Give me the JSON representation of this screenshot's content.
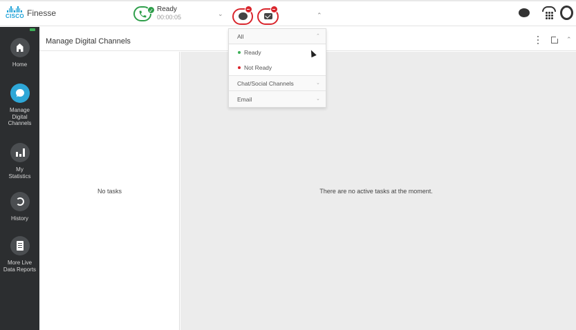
{
  "header": {
    "app_name": "Finesse",
    "logo_text": "CISCO",
    "status": "Ready",
    "status_timer": "00:00:05"
  },
  "sidebar": {
    "items": [
      {
        "label": "Home",
        "icon": "home-icon"
      },
      {
        "label": "Manage Digital Channels",
        "label_lines": [
          "Manage",
          "Digital",
          "Channels"
        ],
        "icon": "chat-bubble-icon",
        "active": true
      },
      {
        "label": "My Statistics",
        "label_lines": [
          "My",
          "Statistics"
        ],
        "icon": "bar-chart-icon"
      },
      {
        "label": "History",
        "icon": "history-icon"
      },
      {
        "label": "More Live Data Reports",
        "label_lines": [
          "More Live",
          "Data Reports"
        ],
        "icon": "report-icon"
      }
    ]
  },
  "gadget": {
    "title": "Manage Digital Channels",
    "empty_tasks": "No tasks",
    "empty_detail": "There are no active tasks at the moment."
  },
  "dropdown": {
    "group_all": "All",
    "options": [
      {
        "label": "Ready",
        "color": "#3db057"
      },
      {
        "label": "Not Ready",
        "color": "#d9242b"
      }
    ],
    "group_chat": "Chat/Social Channels",
    "group_email": "Email"
  },
  "colors": {
    "ready_green": "#2e9e4a",
    "alert_red": "#d9242b",
    "active_blue": "#2ea7d7",
    "sidebar_bg": "#2c2e30"
  }
}
